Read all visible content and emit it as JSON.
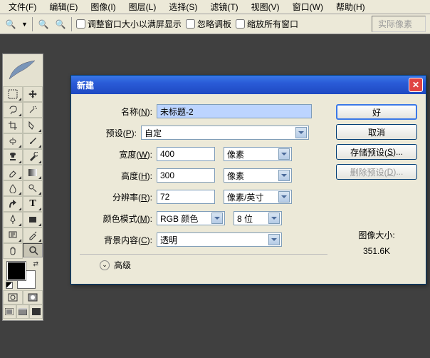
{
  "menu": {
    "file": "文件(F)",
    "edit": "编辑(E)",
    "image": "图像(I)",
    "layer": "图层(L)",
    "select": "选择(S)",
    "filter": "滤镜(T)",
    "view": "视图(V)",
    "window": "窗口(W)",
    "help": "帮助(H)"
  },
  "toolbar": {
    "chk1": "调整窗口大小以满屏显示",
    "chk2": "忽略调板",
    "chk3": "缩放所有窗口",
    "search_ph": "实际像素"
  },
  "dialog": {
    "title": "新建",
    "name_lbl_a": "名称(",
    "name_lbl_u": "N",
    "name_lbl_b": "):",
    "name_val": "未标题-2",
    "preset_lbl_a": "预设(",
    "preset_lbl_u": "P",
    "preset_lbl_b": "):",
    "preset_val": "自定",
    "width_lbl_a": "宽度(",
    "width_lbl_u": "W",
    "width_lbl_b": "):",
    "width_val": "400",
    "width_unit": "像素",
    "height_lbl_a": "高度(",
    "height_lbl_u": "H",
    "height_lbl_b": "):",
    "height_val": "300",
    "height_unit": "像素",
    "res_lbl_a": "分辨率(",
    "res_lbl_u": "R",
    "res_lbl_b": "):",
    "res_val": "72",
    "res_unit": "像素/英寸",
    "mode_lbl_a": "颜色模式(",
    "mode_lbl_u": "M",
    "mode_lbl_b": "):",
    "mode_val": "RGB 颜色",
    "bit_val": "8 位",
    "bg_lbl_a": "背景内容(",
    "bg_lbl_u": "C",
    "bg_lbl_b": "):",
    "bg_val": "透明",
    "adv": "高级",
    "btn_ok": "好",
    "btn_cancel": "取消",
    "btn_save_a": "存储预设(",
    "btn_save_u": "S",
    "btn_save_b": ")...",
    "btn_del_a": "删除预设(",
    "btn_del_u": "D",
    "btn_del_b": ")...",
    "size_lbl": "图像大小:",
    "size_val": "351.6K"
  }
}
